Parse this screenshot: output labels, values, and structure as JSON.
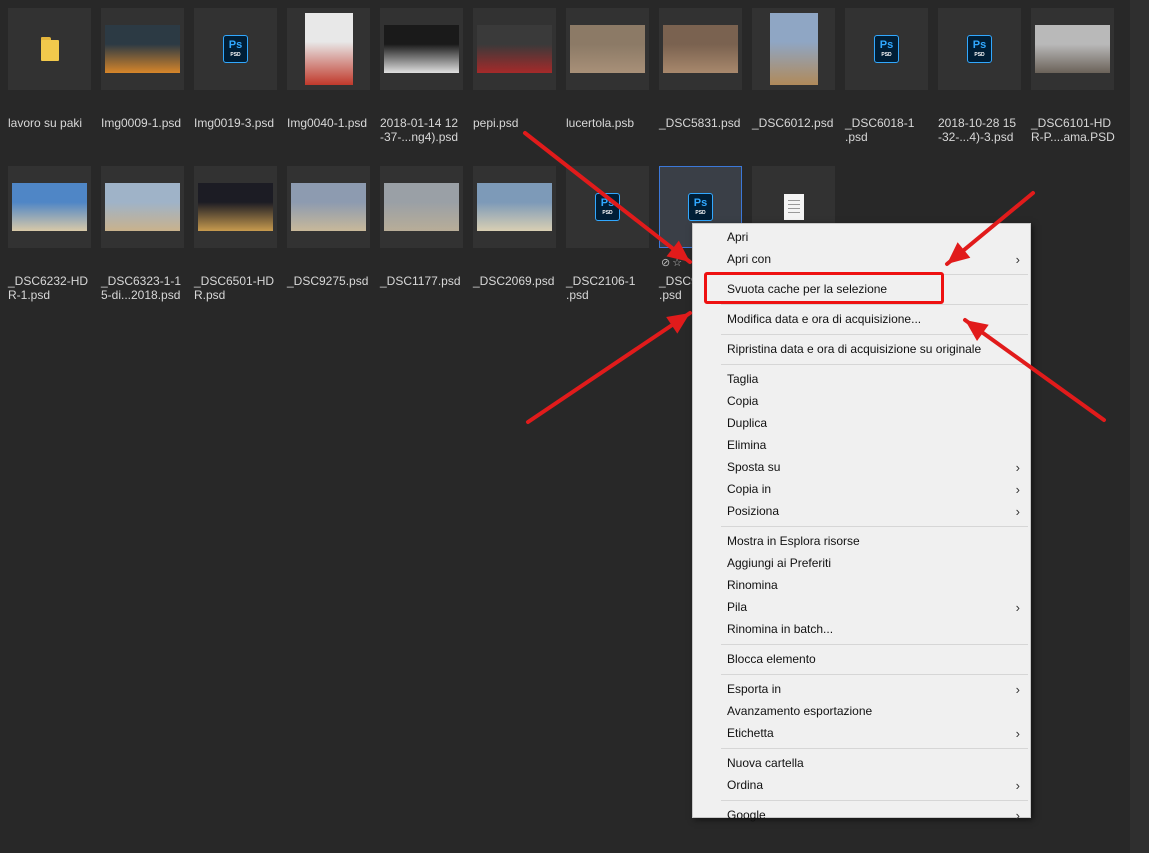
{
  "files_row1": [
    {
      "name": "lavoro su paki",
      "kind": "folder"
    },
    {
      "name": "Img0009-1.psd",
      "kind": "photo",
      "colors": [
        "#2c3a44",
        "#d7862a"
      ]
    },
    {
      "name": "Img0019-3.psd",
      "kind": "psd"
    },
    {
      "name": "Img0040-1.psd",
      "kind": "photo",
      "colors": [
        "#e8e8e8",
        "#c0392b"
      ]
    },
    {
      "name": "2018-01-14 12\n-37-...ng4).psd",
      "kind": "photo",
      "colors": [
        "#1a1a1a",
        "#e0e0e0"
      ]
    },
    {
      "name": "pepi.psd",
      "kind": "photo",
      "colors": [
        "#3a3a3a",
        "#a52a2a"
      ]
    },
    {
      "name": "lucertola.psb",
      "kind": "photo",
      "colors": [
        "#8c7a66",
        "#a89078"
      ]
    },
    {
      "name": "_DSC5831.psd",
      "kind": "photo",
      "colors": [
        "#7a6250",
        "#a8886c"
      ]
    },
    {
      "name": "_DSC6012.psd",
      "kind": "photo",
      "colors": [
        "#8fa6c4",
        "#b08a5a"
      ]
    },
    {
      "name": "_DSC6018-1\n.psd",
      "kind": "psd"
    },
    {
      "name": "2018-10-28 15\n-32-...4)-3.psd",
      "kind": "psd"
    },
    {
      "name": "_DSC6101-HD\nR-P....ama.PSD",
      "kind": "photo",
      "colors": [
        "#b9b9b9",
        "#6b6259"
      ]
    }
  ],
  "files_row2": [
    {
      "name": "_DSC6232-HD\nR-1.psd",
      "kind": "photo",
      "colors": [
        "#4f86c6",
        "#d8c9a8"
      ]
    },
    {
      "name": "_DSC6323-1-1\n5-di...2018.psd",
      "kind": "photo",
      "colors": [
        "#9fb3c8",
        "#c9b28c"
      ]
    },
    {
      "name": "_DSC6501-HD\nR.psd",
      "kind": "photo",
      "colors": [
        "#1c1c24",
        "#c79a4e"
      ]
    },
    {
      "name": "_DSC9275.psd",
      "kind": "photo",
      "colors": [
        "#8d9bb0",
        "#c8b89a"
      ]
    },
    {
      "name": "_DSC1177.psd",
      "kind": "photo",
      "colors": [
        "#9aa0a6",
        "#b8ad98"
      ]
    },
    {
      "name": "_DSC2069.psd",
      "kind": "photo",
      "colors": [
        "#7d9ab8",
        "#d9cfb3"
      ]
    },
    {
      "name": "_DSC2106-1\n.psd",
      "kind": "psd"
    },
    {
      "name": "_DSC9\n.psd",
      "kind": "psd",
      "selected": true
    },
    {
      "name": "",
      "kind": "doc"
    }
  ],
  "psd_icon": {
    "ps": "Ps",
    "label": "PSD"
  },
  "rating_glyphs": "⊘☆",
  "context_menu": [
    {
      "label": "Apri",
      "submenu": false
    },
    {
      "label": "Apri con",
      "submenu": true
    },
    {
      "sep": true
    },
    {
      "label": "Svuota cache per la selezione",
      "submenu": false,
      "highlighted": true
    },
    {
      "sep": true
    },
    {
      "label": "Modifica data e ora di acquisizione...",
      "submenu": false
    },
    {
      "sep": true
    },
    {
      "label": "Ripristina data e ora di acquisizione su originale",
      "submenu": false
    },
    {
      "sep": true
    },
    {
      "label": "Taglia",
      "submenu": false
    },
    {
      "label": "Copia",
      "submenu": false
    },
    {
      "label": "Duplica",
      "submenu": false
    },
    {
      "label": "Elimina",
      "submenu": false
    },
    {
      "label": "Sposta su",
      "submenu": true
    },
    {
      "label": "Copia in",
      "submenu": true
    },
    {
      "label": "Posiziona",
      "submenu": true
    },
    {
      "sep": true
    },
    {
      "label": "Mostra in Esplora risorse",
      "submenu": false
    },
    {
      "label": "Aggiungi ai Preferiti",
      "submenu": false
    },
    {
      "label": "Rinomina",
      "submenu": false
    },
    {
      "label": "Pila",
      "submenu": true
    },
    {
      "label": "Rinomina in batch...",
      "submenu": false
    },
    {
      "sep": true
    },
    {
      "label": "Blocca elemento",
      "submenu": false
    },
    {
      "sep": true
    },
    {
      "label": "Esporta in",
      "submenu": true
    },
    {
      "label": "Avanzamento esportazione",
      "submenu": false
    },
    {
      "label": "Etichetta",
      "submenu": true
    },
    {
      "sep": true
    },
    {
      "label": "Nuova cartella",
      "submenu": false
    },
    {
      "label": "Ordina",
      "submenu": true
    },
    {
      "sep": true
    },
    {
      "label": "Google",
      "submenu": true
    }
  ],
  "submenu_glyph": "›",
  "annotation_color": "#e11b1b"
}
